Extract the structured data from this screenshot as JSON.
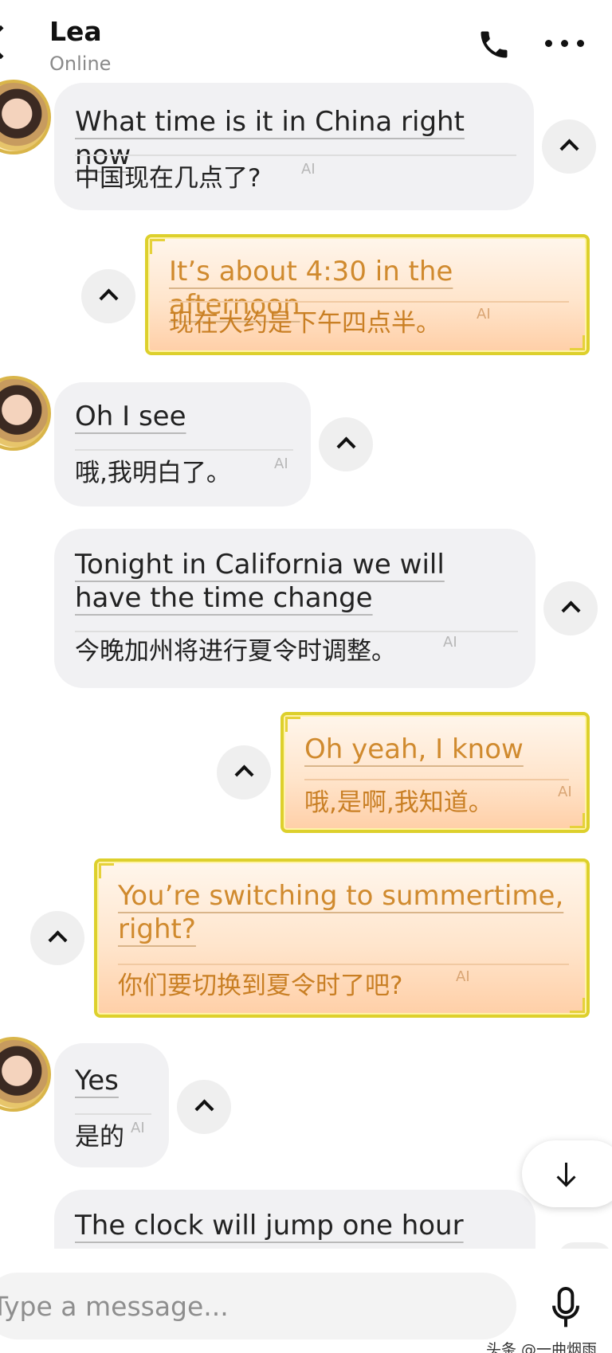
{
  "header": {
    "name": "Lea",
    "status": "Online"
  },
  "messages": [
    {
      "en": "What time is it in China right now",
      "zh": "中国现在几点了?",
      "ai": "AI"
    },
    {
      "en": "It’s about 4:30 in the afternoon",
      "zh": "现在大约是下午四点半。",
      "ai": "AI"
    },
    {
      "en": "Oh I see",
      "zh": "哦,我明白了。",
      "ai": "AI"
    },
    {
      "en": "Tonight in California we will have the time change",
      "zh": "今晚加州将进行夏令时调整。",
      "ai": "AI"
    },
    {
      "en": "Oh yeah, I know",
      "zh": "哦,是啊,我知道。",
      "ai": "AI"
    },
    {
      "en": "You’re switching to summertime, right?",
      "zh": "你们要切换到夏令时了吧?",
      "ai": "AI"
    },
    {
      "en": "Yes",
      "zh": "是的",
      "ai": "AI"
    },
    {
      "en": "The clock will jump one hour"
    }
  ],
  "composer": {
    "placeholder": "Type a message..."
  },
  "watermark": "头条 @一曲烟雨",
  "colors": {
    "incoming_bubble": "#f1f1f3",
    "outgoing_text": "#d08a2e",
    "outgoing_border": "#ddd02c"
  }
}
